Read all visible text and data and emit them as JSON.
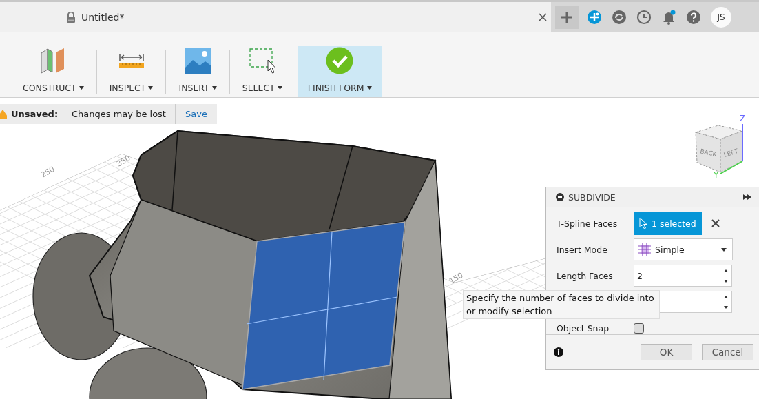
{
  "document_tab": {
    "title": "Untitled*"
  },
  "user": {
    "initials": "JS"
  },
  "toolbar": [
    {
      "kind": "construct",
      "label": "CONSTRUCT",
      "highlighted": false
    },
    {
      "kind": "inspect",
      "label": "INSPECT",
      "highlighted": false
    },
    {
      "kind": "insert",
      "label": "INSERT",
      "highlighted": false
    },
    {
      "kind": "select",
      "label": "SELECT",
      "highlighted": false
    },
    {
      "kind": "finish",
      "label": "FINISH FORM",
      "highlighted": true
    }
  ],
  "notice": {
    "label": "Unsaved:",
    "message": "Changes may be lost",
    "action": "Save"
  },
  "viewport": {
    "grid_labels": [
      "250",
      "350",
      "150"
    ],
    "viewcube_faces": [
      "BACK",
      "LEFT"
    ],
    "axes": [
      "Z",
      "Y"
    ]
  },
  "panel": {
    "title": "SUBDIVIDE",
    "rows": [
      {
        "kind": "selection",
        "label": "T-Spline Faces",
        "value": "1 selected"
      },
      {
        "kind": "dropdown",
        "label": "Insert Mode",
        "value": "Simple"
      },
      {
        "kind": "spinner",
        "label": "Length Faces",
        "value": "2"
      },
      {
        "kind": "spinner"
      },
      {
        "kind": "checkbox",
        "label": "Object Snap",
        "checked": false
      }
    ],
    "buttons": [
      "OK",
      "Cancel"
    ]
  },
  "tooltip": {
    "text": "Specify the number of faces to divide into or modify selection"
  }
}
